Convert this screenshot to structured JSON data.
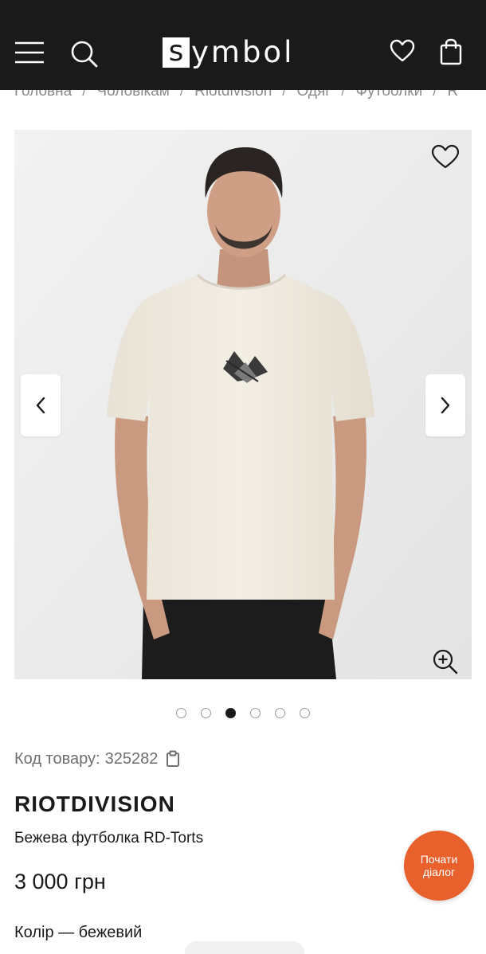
{
  "header": {
    "logo_letter": "s",
    "logo_rest": "ymbol",
    "icons": [
      "menu-icon",
      "search-icon",
      "heart-icon",
      "bag-icon"
    ],
    "background": "#1a1a1a"
  },
  "breadcrumb": {
    "items": [
      "Головна",
      "Чоловікам",
      "Riotdivision",
      "Одяг",
      "Футболки",
      "R"
    ],
    "separator": "/"
  },
  "gallery": {
    "slide_count": 6,
    "active_slide": 3
  },
  "product": {
    "sku_label": "Код товару:",
    "sku_value": "325282",
    "brand": "RIOTDIVISION",
    "title": "Бежева футболка RD-Torts",
    "price": "3 000 грн",
    "color_label": "Колір — бежевий"
  },
  "chat": {
    "line1": "Почати",
    "line2": "діалог",
    "color": "#e8612c"
  }
}
